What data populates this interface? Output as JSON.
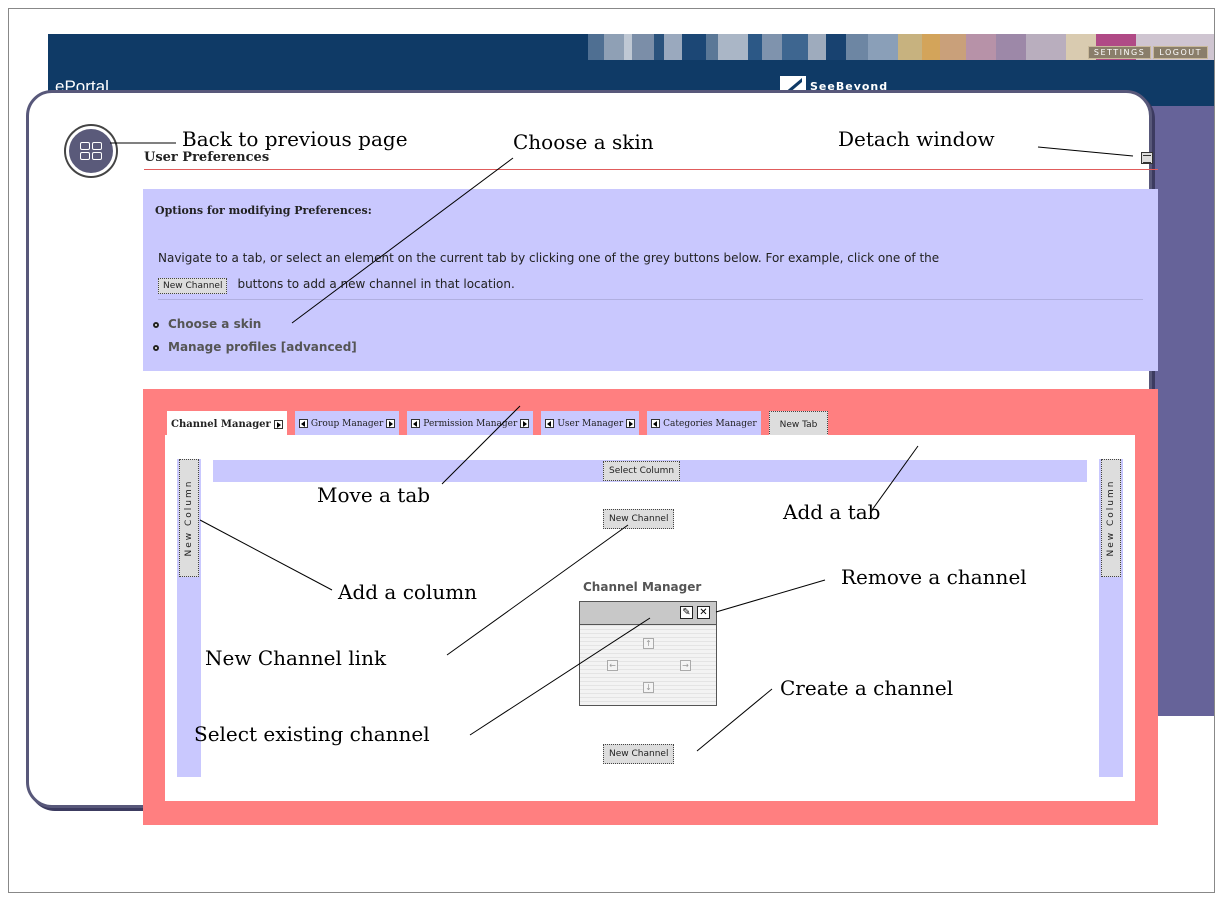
{
  "header": {
    "app_title": "ePortal",
    "brand": "SeeBeyond",
    "settings_label": "SETTINGS",
    "logout_label": "LOGOUT"
  },
  "panel": {
    "title": "User Preferences"
  },
  "options": {
    "heading": "Options for modifying Preferences:",
    "description": "Navigate to a tab, or select an element on the current tab by clicking one of the grey buttons below. For example, click one of the",
    "inline_button": "New Channel",
    "description_tail": "buttons to add a new channel in that location.",
    "links": [
      "Choose a skin",
      "Manage profiles [advanced]"
    ]
  },
  "tabs": {
    "items": [
      "Channel Manager",
      "Group Manager",
      "Permission Manager",
      "User Manager",
      "Categories Manager"
    ],
    "new_tab": "New Tab"
  },
  "layout": {
    "new_column": "New Column",
    "select_column": "Select Column",
    "new_channel": "New Channel",
    "channel_title": "Channel Manager"
  },
  "callouts": {
    "back": "Back to previous page",
    "skin": "Choose a skin",
    "detach": "Detach window",
    "move_tab": "Move a tab",
    "add_tab": "Add a tab",
    "add_column": "Add a column",
    "remove_channel": "Remove a channel",
    "new_channel_link": "New Channel link",
    "create_channel": "Create a channel",
    "select_existing": "Select existing channel"
  },
  "colors": {
    "header_bg": "#0f3a66",
    "app_bg": "#666399",
    "lavender": "#c9c8fe",
    "salmon": "#ff7f80"
  }
}
